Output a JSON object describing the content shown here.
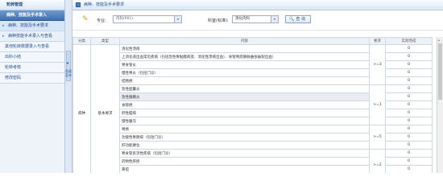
{
  "sidebar": {
    "header": "轮转管理",
    "items": [
      {
        "label": "病种、技能及手术录入",
        "type": "group"
      },
      {
        "label": "病种、技能及手术要求",
        "type": "sub"
      },
      {
        "label": "病种技能手术录入与查看",
        "type": "sub"
      },
      {
        "label": "其他轮转数据录入与查看",
        "type": "item"
      },
      {
        "label": "出科小结",
        "type": "item"
      },
      {
        "label": "轮转考核",
        "type": "item"
      },
      {
        "label": "修改密码",
        "type": "item"
      }
    ],
    "splitter_label": "隐藏菜单"
  },
  "header": {
    "title": "病种、技能及手术要求"
  },
  "filter": {
    "specialty_label": "专业:",
    "specialty_value": "内科(P01)",
    "department_label": "科室(标准):",
    "department_value": "消化内科",
    "query_button": "查 询"
  },
  "table": {
    "headers": [
      "分类",
      "类型",
      "内容",
      "要求",
      "实际完成"
    ],
    "category": "病种",
    "type": "基本要求",
    "rows": [
      {
        "content": "消化性溃疡",
        "actual": "0"
      },
      {
        "content": "上消化道出血常见疾病（包括急性胃黏膜病变、消化性溃疡出血）、食管胃底静脉曲张破裂出血）",
        "actual": "0"
      },
      {
        "content": "胃食管炎",
        "actual": "0"
      },
      {
        "content": "慢性胃炎（包括门诊）",
        "actual": "0"
      },
      {
        "content": "结肠癌",
        "actual": "0"
      },
      {
        "content": "急性胆囊炎",
        "actual": "0"
      },
      {
        "content": "急性胰腺炎",
        "actual": "0"
      },
      {
        "content": "食管癌",
        "actual": "0"
      },
      {
        "content": "肝性脑病",
        "actual": "0"
      },
      {
        "content": "慢性腹泻",
        "actual": "0"
      },
      {
        "content": "胃癌",
        "actual": "0"
      },
      {
        "content": "功能性胃肠病（包括门诊）",
        "actual": "0"
      },
      {
        "content": "肝功能硬化",
        "actual": "0"
      },
      {
        "content": "胃食管反流性疾病（包括门诊）",
        "actual": "0"
      },
      {
        "content": "药物性肝损",
        "actual": "0"
      },
      {
        "content": "黄疸",
        "actual": "0"
      },
      {
        "content": "",
        "actual": "0"
      }
    ],
    "requirements": [
      {
        "label": ">=3",
        "span": 5
      },
      {
        "label": ">=1",
        "span": 5
      },
      {
        "label": ">=5",
        "span": 3
      },
      {
        "label": ">=2",
        "span": 4
      }
    ]
  }
}
